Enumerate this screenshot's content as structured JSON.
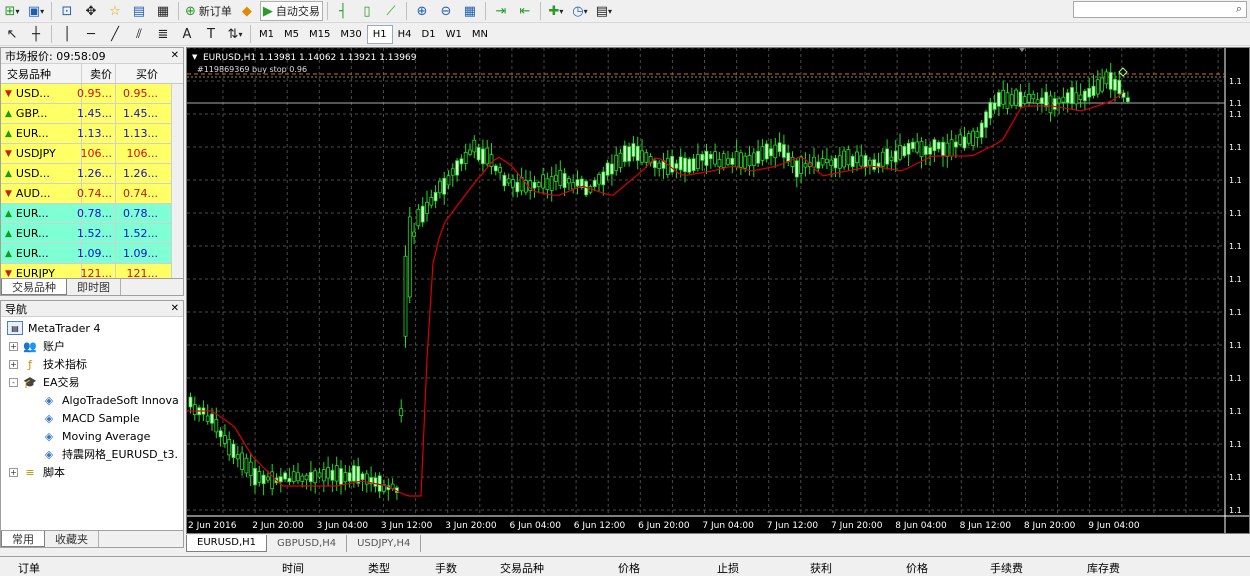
{
  "toolbar1": {
    "new_order_label": "新订单",
    "auto_trade_label": "自动交易"
  },
  "toolbar2": {
    "timeframes": [
      "M1",
      "M5",
      "M15",
      "M30",
      "H1",
      "H4",
      "D1",
      "W1",
      "MN"
    ],
    "active_timeframe": "H1"
  },
  "market_watch": {
    "title": "市场报价: 09:58:09",
    "col_symbol": "交易品种",
    "col_bid": "卖价",
    "col_ask": "买价",
    "rows": [
      {
        "symbol": "USD...",
        "bid": "0.95...",
        "ask": "0.95...",
        "dir": "down",
        "bg": "yellow",
        "vcolor": "red"
      },
      {
        "symbol": "GBP...",
        "bid": "1.45...",
        "ask": "1.45...",
        "dir": "up",
        "bg": "yellow",
        "vcolor": "blue"
      },
      {
        "symbol": "EUR...",
        "bid": "1.13...",
        "ask": "1.13...",
        "dir": "up",
        "bg": "yellow",
        "vcolor": "blue"
      },
      {
        "symbol": "USDJPY",
        "bid": "106...",
        "ask": "106...",
        "dir": "down",
        "bg": "yellow",
        "vcolor": "red"
      },
      {
        "symbol": "USD...",
        "bid": "1.26...",
        "ask": "1.26...",
        "dir": "up",
        "bg": "yellow",
        "vcolor": "blue"
      },
      {
        "symbol": "AUD...",
        "bid": "0.74...",
        "ask": "0.74...",
        "dir": "down",
        "bg": "yellow",
        "vcolor": "red"
      },
      {
        "symbol": "EUR...",
        "bid": "0.78...",
        "ask": "0.78...",
        "dir": "up",
        "bg": "cyan",
        "vcolor": "blue"
      },
      {
        "symbol": "EUR...",
        "bid": "1.52...",
        "ask": "1.52...",
        "dir": "up",
        "bg": "cyan",
        "vcolor": "blue"
      },
      {
        "symbol": "EUR...",
        "bid": "1.09...",
        "ask": "1.09...",
        "dir": "up",
        "bg": "cyan",
        "vcolor": "blue"
      },
      {
        "symbol": "EURJPY",
        "bid": "121...",
        "ask": "121...",
        "dir": "down",
        "bg": "yellow",
        "vcolor": "red"
      }
    ],
    "tabs": [
      "交易品种",
      "即时图"
    ]
  },
  "navigator": {
    "title": "导航",
    "root": "MetaTrader 4",
    "items": [
      {
        "label": "账户",
        "level": 1,
        "icon": "accounts-icon",
        "exp": "+"
      },
      {
        "label": "技术指标",
        "level": 1,
        "icon": "indicators-icon",
        "exp": "+"
      },
      {
        "label": "EA交易",
        "level": 1,
        "icon": "expert-advisors-icon",
        "exp": "-"
      },
      {
        "label": "AlgoTradeSoft Innova",
        "level": 2,
        "icon": "ea-hat-icon",
        "exp": ""
      },
      {
        "label": "MACD Sample",
        "level": 2,
        "icon": "ea-hat-icon",
        "exp": ""
      },
      {
        "label": "Moving Average",
        "level": 2,
        "icon": "ea-hat-icon",
        "exp": ""
      },
      {
        "label": "持震网格_EURUSD_t3.",
        "level": 2,
        "icon": "ea-hat-icon",
        "exp": ""
      },
      {
        "label": "脚本",
        "level": 1,
        "icon": "scripts-icon",
        "exp": "+"
      }
    ],
    "tabs": [
      "常用",
      "收藏夹"
    ]
  },
  "chart": {
    "header": "EURUSD,H1  1.13981 1.14062 1.13921 1.13969",
    "order_label": "#119869369 buy stop 0.96",
    "time_labels": [
      "2 Jun 2016",
      "2 Jun 20:00",
      "3 Jun 04:00",
      "3 Jun 12:00",
      "3 Jun 20:00",
      "6 Jun 04:00",
      "6 Jun 12:00",
      "6 Jun 20:00",
      "7 Jun 04:00",
      "7 Jun 12:00",
      "7 Jun 20:00",
      "8 Jun 04:00",
      "8 Jun 12:00",
      "8 Jun 20:00",
      "9 Jun 04:00"
    ],
    "price_label": "1.1",
    "current_price_label": "1.1",
    "colors": {
      "bg": "#000000",
      "bull": "#ccffcc",
      "bear": "#000000",
      "wick": "#22dd22",
      "ma": "#dd0000",
      "grid": "#4a4a4a"
    }
  },
  "chart_data": {
    "type": "candlestick",
    "symbol": "EURUSD",
    "timeframe": "H1",
    "ohlc_last": {
      "open": 1.13981,
      "high": 1.14062,
      "low": 1.13921,
      "close": 1.13969
    },
    "moving_average": true
  },
  "chart_tabs": [
    "EURUSD,H1",
    "GBPUSD,H4",
    "USDJPY,H4"
  ],
  "terminal": {
    "columns": [
      "订单",
      "时间",
      "类型",
      "手数",
      "交易品种",
      "价格",
      "止损",
      "获利",
      "价格",
      "手续费",
      "库存费"
    ]
  }
}
